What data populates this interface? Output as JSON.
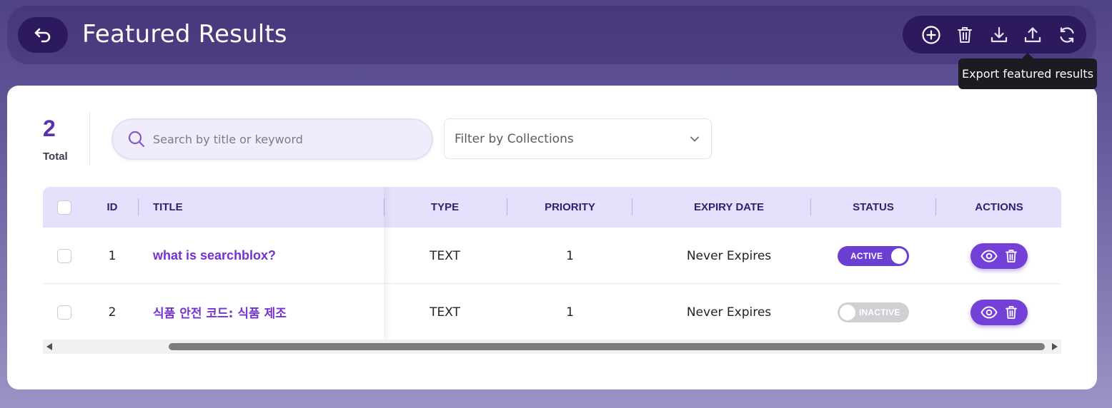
{
  "header": {
    "title": "Featured Results"
  },
  "toolbar": {
    "tooltip": "Export featured results",
    "icons": [
      "plus-circle-icon",
      "trash-icon",
      "download-icon",
      "upload-icon",
      "refresh-icon"
    ]
  },
  "summary": {
    "total": "2",
    "total_label": "Total"
  },
  "search": {
    "placeholder": "Search by title or keyword",
    "value": ""
  },
  "filter": {
    "placeholder": "Filter by Collections"
  },
  "table": {
    "columns": {
      "id": "ID",
      "title": "TITLE",
      "type": "TYPE",
      "priority": "PRIORITY",
      "expiry": "EXPIRY DATE",
      "status": "STATUS",
      "actions": "ACTIONS"
    },
    "rows": [
      {
        "id": "1",
        "title": "what is searchblox?",
        "type": "TEXT",
        "priority": "1",
        "expiry": "Never Expires",
        "status": "ACTIVE",
        "active": true
      },
      {
        "id": "2",
        "title": "식품 안전 코드: 식품 제조",
        "type": "TEXT",
        "priority": "1",
        "expiry": "Never Expires",
        "status": "INACTIVE",
        "active": false
      }
    ]
  },
  "colors": {
    "accent": "#7340d8",
    "header_dark": "#2d1a5e",
    "table_header": "#e6e0fd",
    "title_link": "#7433d1"
  }
}
